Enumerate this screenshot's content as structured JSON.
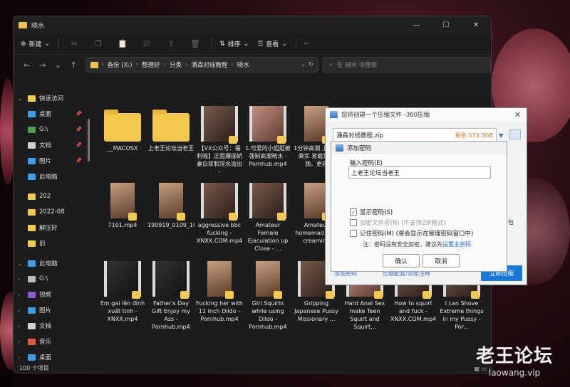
{
  "window": {
    "title": "晓水"
  },
  "toolbar": {
    "new_label": "新建",
    "sort_label": "排序",
    "view_label": "查看",
    "more_label": "···"
  },
  "address": {
    "crumbs": [
      "备份 (X:)",
      "整理好",
      "分类",
      "潘森对线教程",
      "晓水"
    ]
  },
  "search": {
    "placeholder": "在 晓水 中搜索"
  },
  "sidebar": {
    "items": [
      {
        "label": "快速访问",
        "icon": "star-icon",
        "color": "#f2c94c"
      },
      {
        "label": "桌面",
        "icon": "desktop-icon",
        "color": "#3d9ee8"
      },
      {
        "label": "G:\\",
        "icon": "download-icon",
        "color": "#4aa04a"
      },
      {
        "label": "文档",
        "icon": "document-icon",
        "color": "#cfcfcf"
      },
      {
        "label": "图片",
        "icon": "pictures-icon",
        "color": "#3d9ee8"
      },
      {
        "label": "此电脑",
        "icon": "pc-icon",
        "color": "#3d9ee8"
      },
      {
        "label": "202",
        "icon": "folder-icon",
        "color": "#f2c94c"
      },
      {
        "label": "2022-08",
        "icon": "folder-icon",
        "color": "#f2c94c"
      },
      {
        "label": "解压好",
        "icon": "folder-icon",
        "color": "#f2c94c"
      },
      {
        "label": "旧",
        "icon": "folder-icon",
        "color": "#f2c94c"
      },
      {
        "label": "此电脑",
        "icon": "pc-icon",
        "color": "#3d9ee8"
      },
      {
        "label": "G:\\",
        "icon": "drive-icon",
        "color": "#bbbbbb"
      },
      {
        "label": "视频",
        "icon": "video-icon",
        "color": "#8a5ad0"
      },
      {
        "label": "图片",
        "icon": "pictures-icon",
        "color": "#3d9ee8"
      },
      {
        "label": "文档",
        "icon": "document-icon",
        "color": "#cfcfcf"
      },
      {
        "label": "音乐",
        "icon": "music-icon",
        "color": "#e05a3a"
      },
      {
        "label": "桌面",
        "icon": "desktop-icon",
        "color": "#3d9ee8"
      }
    ]
  },
  "files": [
    {
      "name": "__MACOSX",
      "kind": "folder"
    },
    {
      "name": "上老王论坛当老王",
      "kind": "folder"
    },
    {
      "name": "【VX公众号：福利喵】正面爆操娇妻白浆和淫水溢出 -",
      "kind": "video"
    },
    {
      "name": "1.可爱的小姐姐被强制高潮晓水 - Pornhub.mp4",
      "kind": "video"
    },
    {
      "name": "1分钟高潮 上位骑乘实 易载到子 颈。更容",
      "kind": "photo"
    },
    {
      "name": "7101.mp4",
      "kind": "photo"
    },
    {
      "name": "190919_0109_1080P_4000K_83314601.mp4",
      "kind": "photo"
    },
    {
      "name": "aggressive bbc fucking - XNXX.COM.mp4",
      "kind": "video"
    },
    {
      "name": "Amateur Female Ejaculation up Close - ...",
      "kind": "video"
    },
    {
      "name": "Amateur homemad wife creaming",
      "kind": "photo"
    },
    {
      "name": "Em gai lên đỉnh xuất tinh - XNXX.mp4",
      "kind": "video"
    },
    {
      "name": "Father's Day Gift Enjoy my Ass - Pornhub.mp4",
      "kind": "video"
    },
    {
      "name": "Fucking her with 11 Inch Dildo - Pornhub.mp4",
      "kind": "photo"
    },
    {
      "name": "Girl Squirts while using Dildo - Pornhub.mp4",
      "kind": "photo"
    },
    {
      "name": "Gripping Japanese Pussy Missionary ...",
      "kind": "video"
    },
    {
      "name": "Hard Anal Sex make Teen Squirt and Squirt...",
      "kind": "video"
    },
    {
      "name": "How to squirt and fuck - XNXX.COM.mp4",
      "kind": "video"
    },
    {
      "name": "I can Shove Extreme things in my Pussy - Por...",
      "kind": "video"
    }
  ],
  "status": {
    "count": "100 个项目"
  },
  "zip_dialog": {
    "title": "您将创建一个压缩文件 -360压缩",
    "filename": "潘森对线教程.zip",
    "space": "剩余:573.5GB",
    "footer_left": "添加密码",
    "footer_left2": "压缩配置/添加注释",
    "start_button": "立即压缩",
    "side_text": "包"
  },
  "password_dialog": {
    "title": "添加密码",
    "prompt": "输入密码(E)",
    "password_value": "上老王论坛当老王",
    "show_password": "显示密码(S)",
    "encrypt_names": "加密文件名(N) (不支持ZIP格式)",
    "remember": "记住密码(M) (将会显示在管理密码窗口中)",
    "note": "注：密码没有安全加密，建议先",
    "note_link": "设置主密码",
    "ok": "确认",
    "cancel": "取消"
  },
  "watermark": {
    "title": "老王论坛",
    "url": "laowang.vip"
  }
}
